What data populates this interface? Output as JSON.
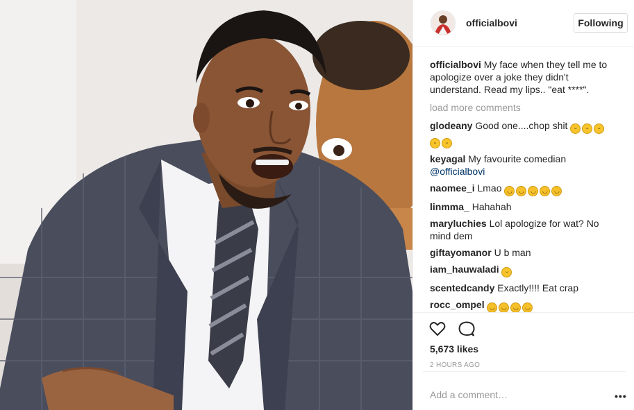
{
  "post": {
    "username": "officialbovi",
    "follow_label": "Following",
    "caption_user": "officialbovi",
    "caption_text": "My face when they tell me to apologize over a joke they didn't understand. Read my lips.. \"eat ****\".",
    "load_more": "load more comments",
    "likes": "5,673 likes",
    "time": "2 HOURS AGO",
    "comment_placeholder": "Add a comment…",
    "more_label": "•••"
  },
  "comments": [
    {
      "user": "glodeany",
      "text": "Good one....chop shit",
      "emoji": [
        "grin",
        "grin",
        "grin",
        "grin",
        "grin"
      ]
    },
    {
      "user": "keyagal",
      "text": "My favourite comedian",
      "mention": "@officialbovi"
    },
    {
      "user": "naomee_i",
      "text": "Lmao",
      "emoji": [
        "tears",
        "tears",
        "tears",
        "tears",
        "tears"
      ]
    },
    {
      "user": "linmma_",
      "text": "Hahahah"
    },
    {
      "user": "maryluchies",
      "text": "Lol apologize for wat? No mind dem"
    },
    {
      "user": "giftayomanor",
      "text": "U b man"
    },
    {
      "user": "iam_hauwaladi",
      "text": "",
      "emoji": [
        "grin"
      ]
    },
    {
      "user": "scentedcandy",
      "text": "Exactly!!!! Eat crap"
    },
    {
      "user": "rocc_ompel",
      "text": "",
      "emoji": [
        "tears",
        "tears",
        "tears",
        "tears"
      ]
    },
    {
      "user": "rocc_ompel",
      "text": "",
      "emoji": [
        "tears",
        "tears",
        "tears",
        "tears"
      ]
    }
  ],
  "colors": {
    "link": "#003569",
    "muted": "#999999",
    "border": "#efefef",
    "suit": "#4a4d5c"
  },
  "icons": {
    "like": "heart-outline-icon",
    "comment": "speech-bubble-icon",
    "more": "ellipsis-icon"
  }
}
